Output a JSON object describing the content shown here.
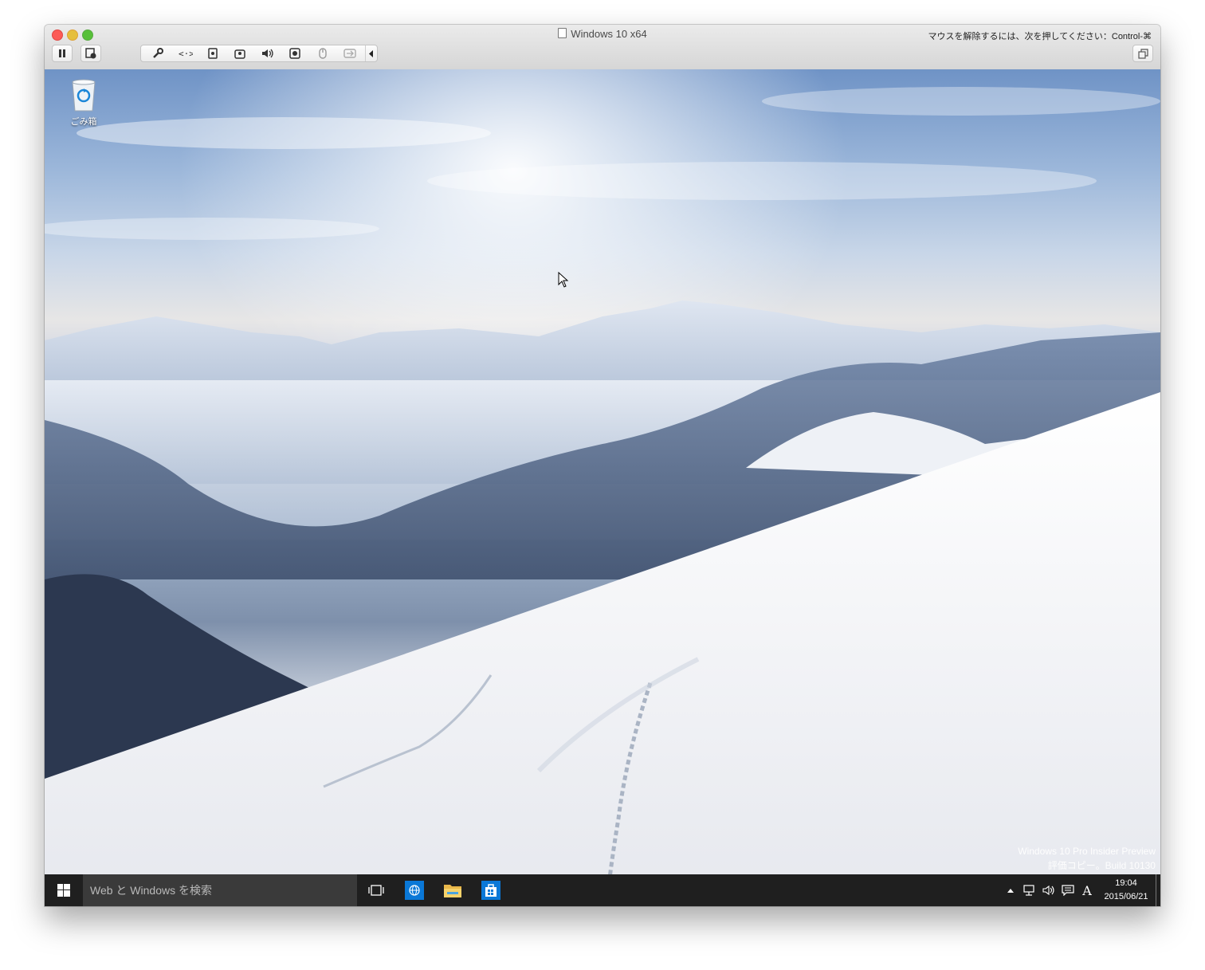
{
  "window": {
    "title": "Windows 10 x64",
    "mouse_release_hint": "マウスを解除するには、次を押してください：Control-⌘"
  },
  "toolbar": {
    "icons": [
      "pause-icon",
      "suspend-icon",
      "settings-wrench-icon",
      "network-icon",
      "hard-disk-icon",
      "cd-dvd-icon",
      "sound-icon",
      "camera-icon",
      "usb-icon",
      "shared-folder-icon",
      "collapse-arrow-icon",
      "fullscreen-icon"
    ]
  },
  "desktop": {
    "recycle_bin_label": "ごみ箱",
    "watermark": {
      "line1": "Windows 10 Pro Insider Preview",
      "line2": "評価コピー。Build 10130"
    }
  },
  "taskbar": {
    "search_placeholder": "Web と Windows を検索",
    "ime_indicator": "A",
    "clock": {
      "time": "19:04",
      "date": "2015/06/21"
    },
    "colors": {
      "taskbar_bg": "#1f1f1f",
      "search_bg": "#3a3a3a",
      "app_blue": "#0a78d7"
    }
  }
}
